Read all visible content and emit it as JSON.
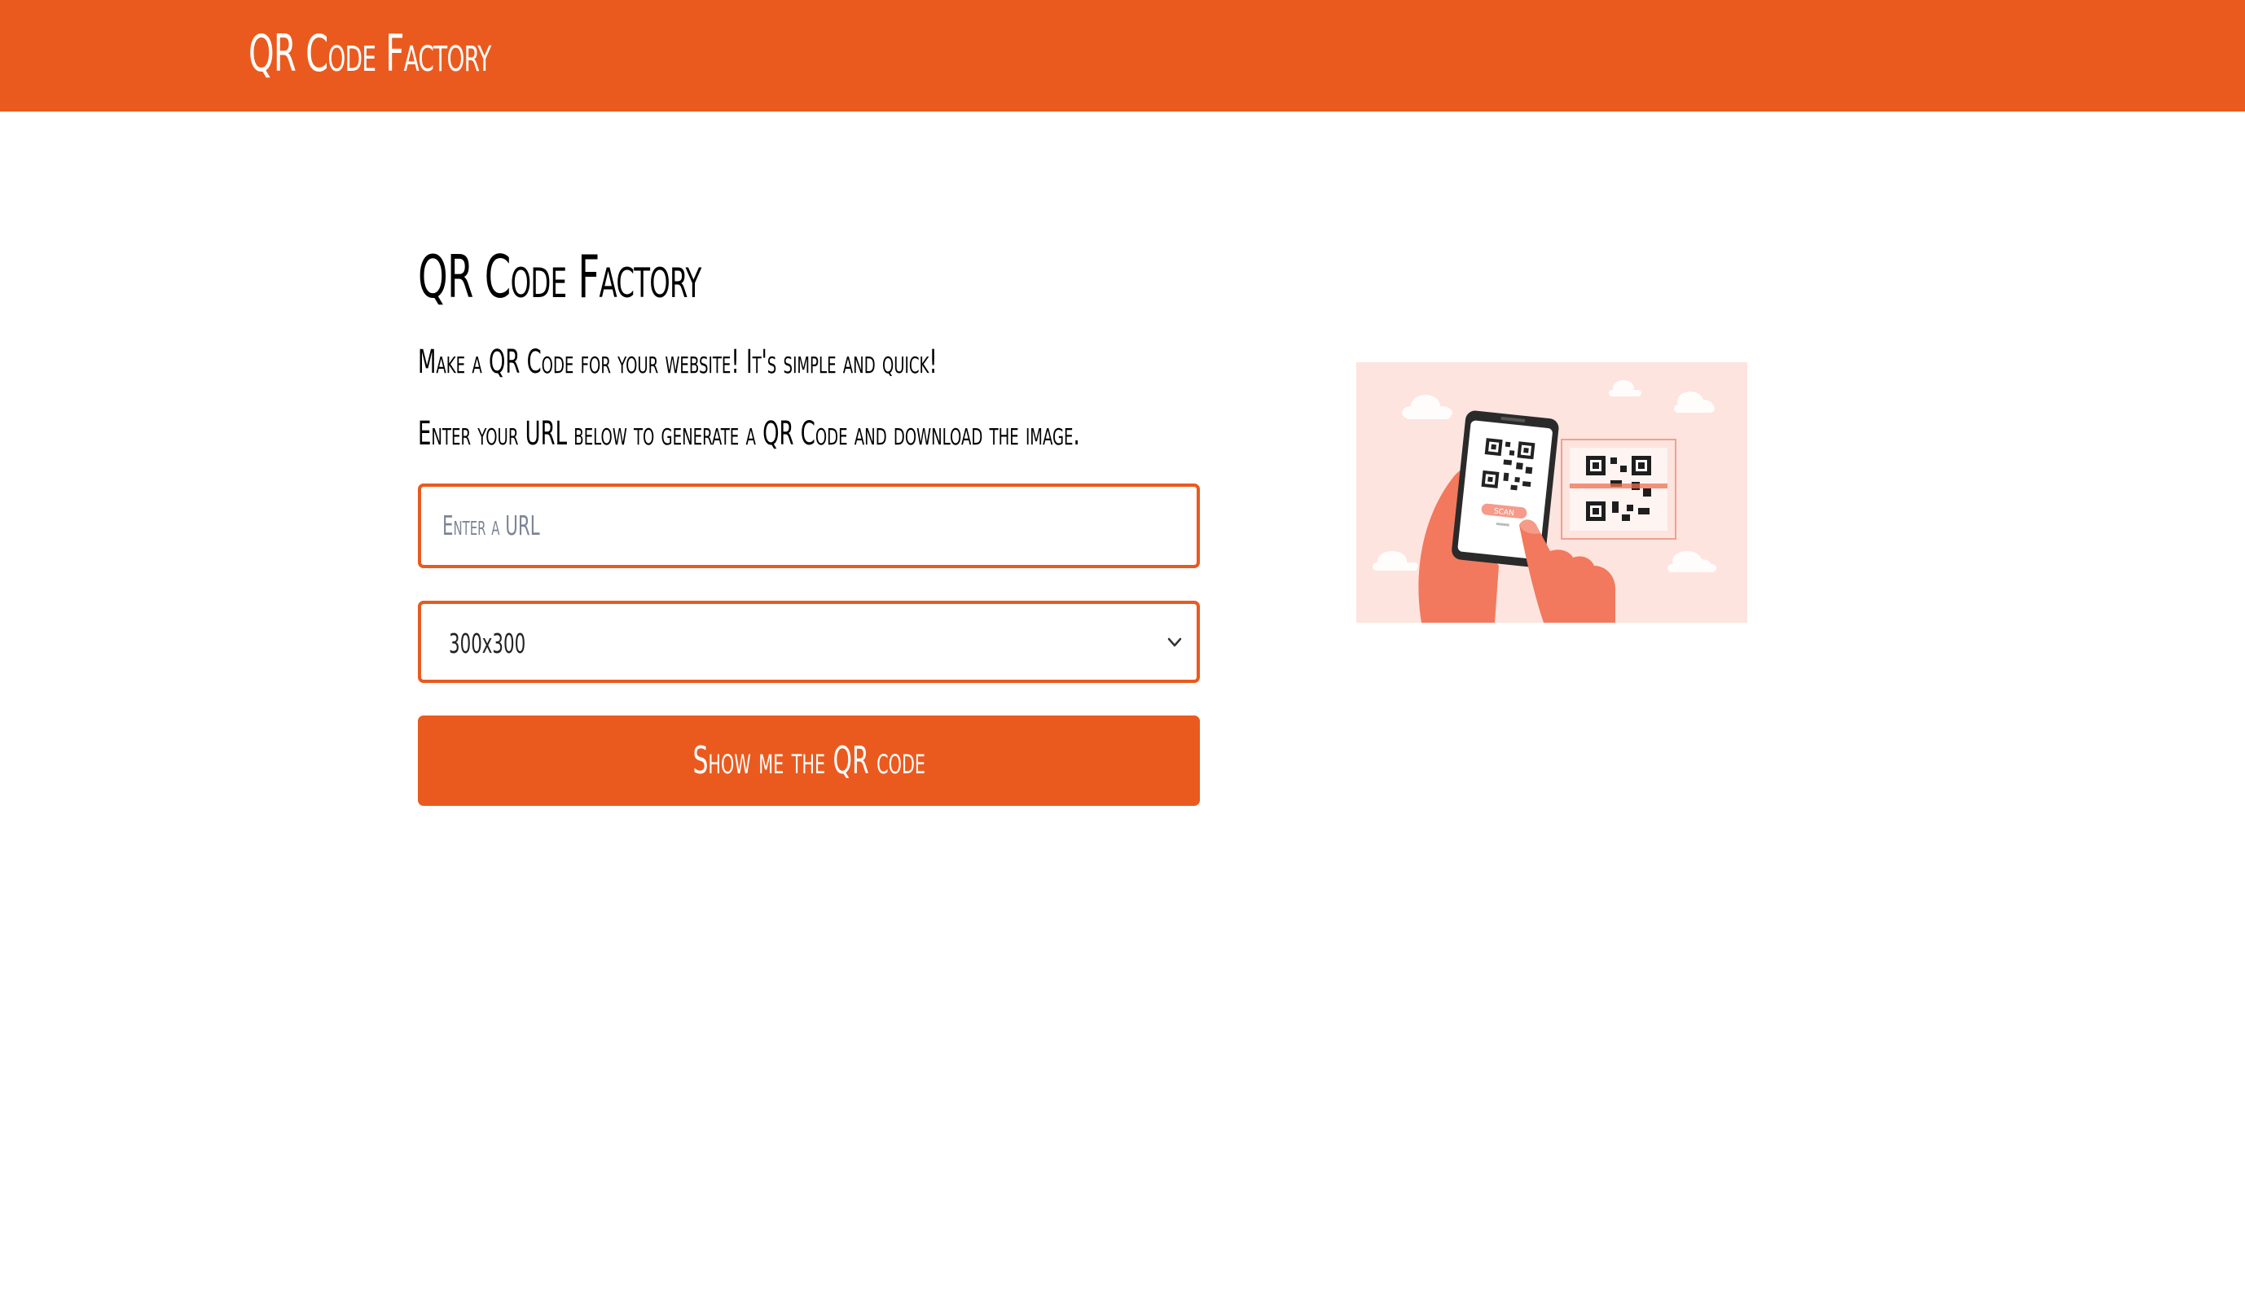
{
  "header": {
    "brand": "QR Code Factory"
  },
  "main": {
    "title": "QR Code Factory",
    "intro_line_1": "Make a QR Code for your website! It's simple and quick!",
    "intro_line_2": "Enter your URL below to generate a QR Code and download the image.",
    "url_input": {
      "placeholder": "Enter a URL",
      "value": ""
    },
    "size_select": {
      "selected": "300x300"
    },
    "submit_label": "Show me the QR code"
  },
  "illustration": {
    "scan_label": "SCAN"
  },
  "colors": {
    "accent": "#ea5a1e",
    "illustration_bg": "#fde4df"
  },
  "icons": {
    "select_arrow": "chevron-down-icon"
  }
}
